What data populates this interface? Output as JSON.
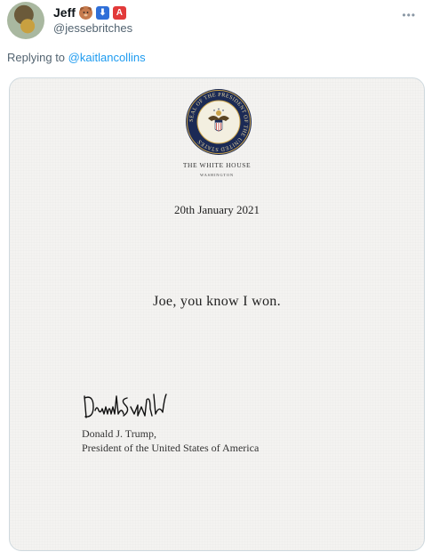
{
  "tweet": {
    "display_name": "Jeff",
    "badges": [
      "bear-emoji",
      "down-arrow-emoji",
      "letter-a-emoji"
    ],
    "badge_text": [
      "",
      "⬇",
      "A"
    ],
    "handle": "@jessebritches",
    "more_label": "•••",
    "replying_prefix": "Replying to",
    "replying_to": "@kaitlancollins"
  },
  "letter": {
    "header": "THE WHITE HOUSE",
    "subheader": "WASHINGTON",
    "date": "20th January 2021",
    "message": "Joe, you know I won.",
    "signer_name": "Donald J. Trump,",
    "signer_title": "President of the United States of America"
  },
  "seal": {
    "outer_text": "SEAL OF THE PRESIDENT OF THE UNITED STATES"
  },
  "colors": {
    "link": "#1d9bf0",
    "muted": "#536471",
    "seal_blue": "#1b2a55",
    "seal_gold": "#c9a24a"
  }
}
